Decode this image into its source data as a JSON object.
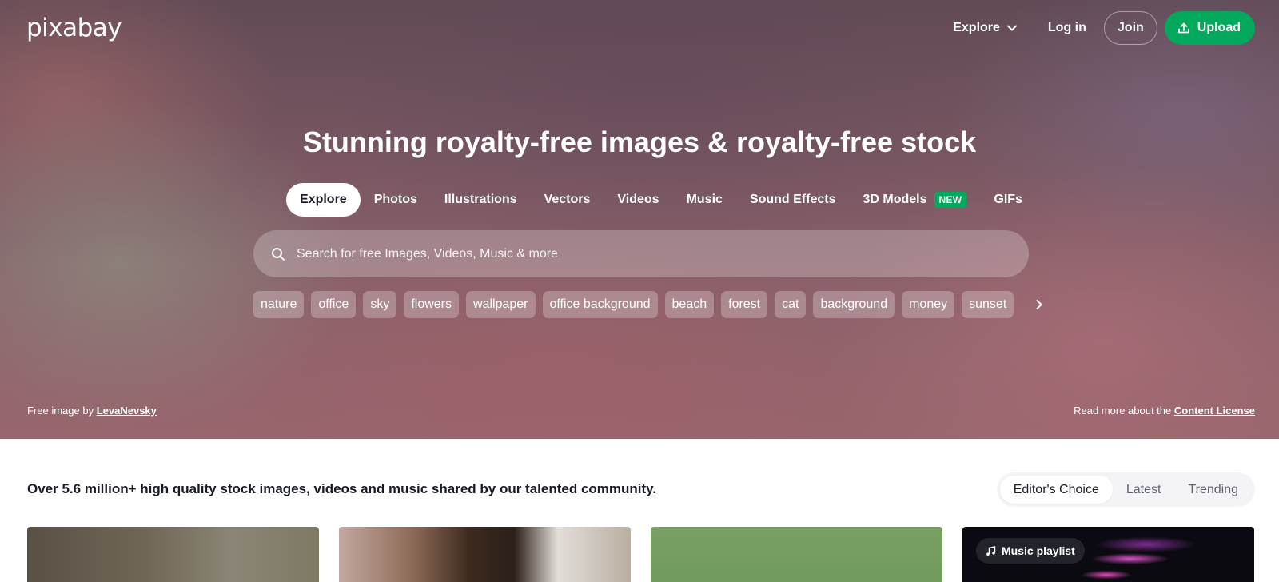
{
  "brand": {
    "logo_text": "pixabay",
    "accent_color": "#02a95c"
  },
  "header": {
    "explore_label": "Explore",
    "login_label": "Log in",
    "join_label": "Join",
    "upload_label": "Upload"
  },
  "hero": {
    "title": "Stunning royalty-free images & royalty-free stock",
    "media_tabs": [
      {
        "label": "Explore",
        "active": true
      },
      {
        "label": "Photos"
      },
      {
        "label": "Illustrations"
      },
      {
        "label": "Vectors"
      },
      {
        "label": "Videos"
      },
      {
        "label": "Music"
      },
      {
        "label": "Sound Effects"
      },
      {
        "label": "3D Models",
        "badge": "NEW"
      },
      {
        "label": "GIFs"
      }
    ],
    "search": {
      "placeholder": "Search for free Images, Videos, Music & more",
      "value": ""
    },
    "tags": [
      "nature",
      "office",
      "sky",
      "flowers",
      "wallpaper",
      "office background",
      "beach",
      "forest",
      "cat",
      "background",
      "money",
      "sunset"
    ],
    "credit_prefix": "Free image by",
    "credit_author": "LevaNevsky",
    "license_prefix": "Read more about the",
    "license_link": "Content License"
  },
  "main": {
    "intro": "Over 5.6 million+ high quality stock images, videos and music shared by our talented community.",
    "sort_tabs": [
      {
        "label": "Editor's Choice",
        "active": true
      },
      {
        "label": "Latest"
      },
      {
        "label": "Trending"
      }
    ],
    "music_card_label": "Music playlist"
  },
  "icons": [
    "chevron-down-icon",
    "upload-icon",
    "search-icon",
    "chevron-right-icon",
    "music-note-icon"
  ]
}
